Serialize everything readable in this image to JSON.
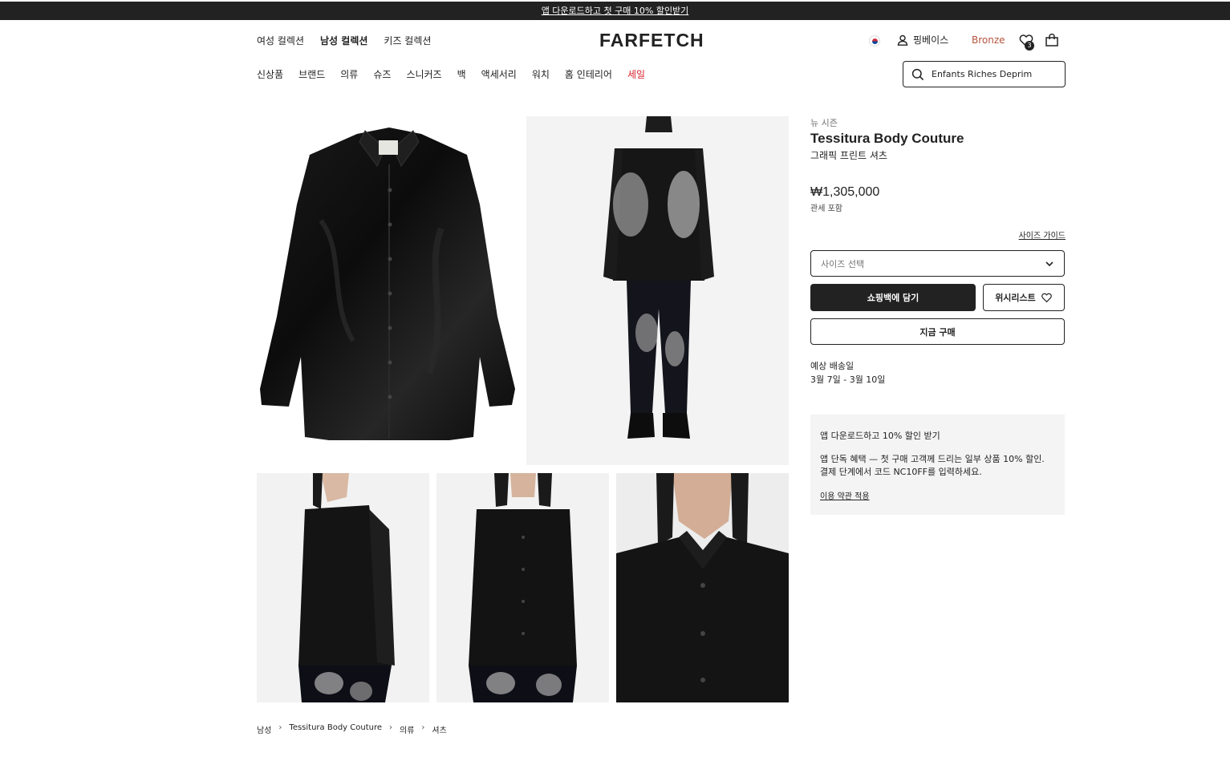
{
  "promo_banner": {
    "text": "앱 다운로드하고 첫 구매 10% 할인받기"
  },
  "header": {
    "logo": "FARFETCH",
    "gender_tabs": [
      {
        "label": "여성 컬렉션",
        "active": false
      },
      {
        "label": "남성 컬렉션",
        "active": true
      },
      {
        "label": "키즈 컬렉션",
        "active": false
      }
    ],
    "account_label": "핑베이스",
    "tier": "Bronze",
    "tier_color": "#b5533c",
    "wishlist_count": "3",
    "icons": [
      "korea-flag-icon",
      "user-icon",
      "heart-icon",
      "bag-icon",
      "search-icon"
    ]
  },
  "categories": [
    {
      "label": "신상품"
    },
    {
      "label": "브랜드"
    },
    {
      "label": "의류"
    },
    {
      "label": "슈즈"
    },
    {
      "label": "스니커즈"
    },
    {
      "label": "백"
    },
    {
      "label": "액세서리"
    },
    {
      "label": "워치"
    },
    {
      "label": "홈 인테리어"
    },
    {
      "label": "세일",
      "sale": true
    }
  ],
  "search": {
    "value": "Enfants Riches Deprim"
  },
  "product": {
    "season": "뉴 시즌",
    "brand": "Tessitura Body Couture",
    "name": "그래픽 프린트 셔츠",
    "price": "₩1,305,000",
    "tax_note": "관세 포함",
    "size_guide": "사이즈 가이드",
    "size_placeholder": "사이즈 선택",
    "add_to_bag": "쇼핑백에 담기",
    "wishlist": "위시리스트",
    "buy_now": "지금 구매",
    "delivery_title": "예상 배송일",
    "delivery_dates": "3월 7일 - 3월 10일"
  },
  "app_promo": {
    "title": "앱 다운로드하고 10% 할인 받기",
    "body": "앱 단독 혜택 — 첫 구매 고객께 드리는 일부 상품 10% 할인. 결제 단계에서 코드 NC10FF를 입력하세요.",
    "terms": "이용 약관 적용"
  },
  "breadcrumb": [
    "남성",
    "Tessitura Body Couture",
    "의류",
    "셔츠"
  ],
  "colors": {
    "dark": "#222222",
    "sale": "#d9232d",
    "panel": "#f4f4f4"
  }
}
